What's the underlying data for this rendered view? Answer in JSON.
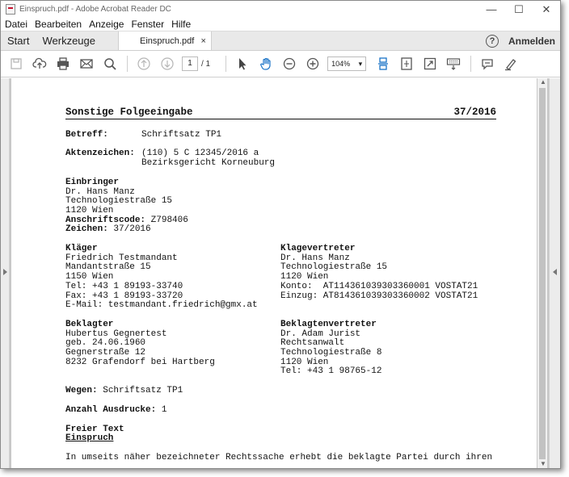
{
  "window": {
    "title": "Einspruch.pdf - Adobe Acrobat Reader DC",
    "controls": {
      "minimize": "—",
      "maximize": "☐",
      "close": "✕"
    }
  },
  "menu": [
    "Datei",
    "Bearbeiten",
    "Anzeige",
    "Fenster",
    "Hilfe"
  ],
  "tabs": {
    "start": "Start",
    "tools": "Werkzeuge",
    "document": "Einspruch.pdf",
    "close": "×"
  },
  "header": {
    "help": "?",
    "signin": "Anmelden"
  },
  "toolbar": {
    "page_current": "1",
    "page_total": "/ 1",
    "zoom": "104%",
    "icons": [
      "save-icon",
      "upload-cloud-icon",
      "print-icon",
      "email-icon",
      "search-icon",
      "page-up-icon",
      "page-down-icon",
      "select-cursor-icon",
      "hand-icon",
      "zoom-out-icon",
      "zoom-in-icon",
      "scroll-mode-icon",
      "fit-page-icon",
      "full-screen-icon",
      "keyboard-icon",
      "comment-icon",
      "highlight-icon"
    ]
  },
  "document": {
    "title": "Sonstige Folgeeingabe",
    "number": "37/2016",
    "betreff_label": "Betreff:",
    "betreff_value": "Schriftsatz TP1",
    "aktenzeichen_label": "Aktenzeichen:",
    "aktenzeichen_line1": "(110) 5 C 12345/2016 a",
    "aktenzeichen_line2": "Bezirksgericht Korneuburg",
    "einbringer": {
      "heading": "Einbringer",
      "lines": [
        "Dr. Hans Manz",
        "Technologiestraße 15",
        "1120 Wien"
      ],
      "code_label": "Anschriftscode:",
      "code_value": "Z798406",
      "zeichen_label": "Zeichen:",
      "zeichen_value": "37/2016"
    },
    "klaeger": {
      "heading": "Kläger",
      "lines": [
        "Friedrich Testmandant",
        "Mandantstraße 15",
        "1150 Wien",
        "Tel: +43 1 89193-33740",
        "Fax: +43 1 89193-33720",
        "E-Mail: testmandant.friedrich@gmx.at"
      ]
    },
    "klagevertreter": {
      "heading": "Klagevertreter",
      "lines": [
        "Dr. Hans Manz",
        "Technologiestraße 15",
        "1120 Wien",
        "Konto:  AT114361039303360001 VOSTAT21",
        "Einzug: AT814361039303360002 VOSTAT21"
      ]
    },
    "beklagter": {
      "heading": "Beklagter",
      "lines": [
        "Hubertus Gegnertest",
        "geb. 24.06.1960",
        "Gegnerstraße 12",
        "8232 Grafendorf bei Hartberg"
      ]
    },
    "beklagtenvertreter": {
      "heading": "Beklagtenvertreter",
      "lines": [
        "Dr. Adam Jurist",
        "Rechtsanwalt",
        "Technologiestraße 8",
        "1120 Wien",
        "Tel: +43 1 98765-12"
      ]
    },
    "wegen_label": "Wegen:",
    "wegen_value": "Schriftsatz TP1",
    "ausdrucke_label": "Anzahl Ausdrucke:",
    "ausdrucke_value": "1",
    "freier_text": "Freier Text",
    "einspruch": "Einspruch",
    "body_start": "In umseits näher bezeichneter Rechtssache erhebt die beklagte Partei durch ihren"
  }
}
